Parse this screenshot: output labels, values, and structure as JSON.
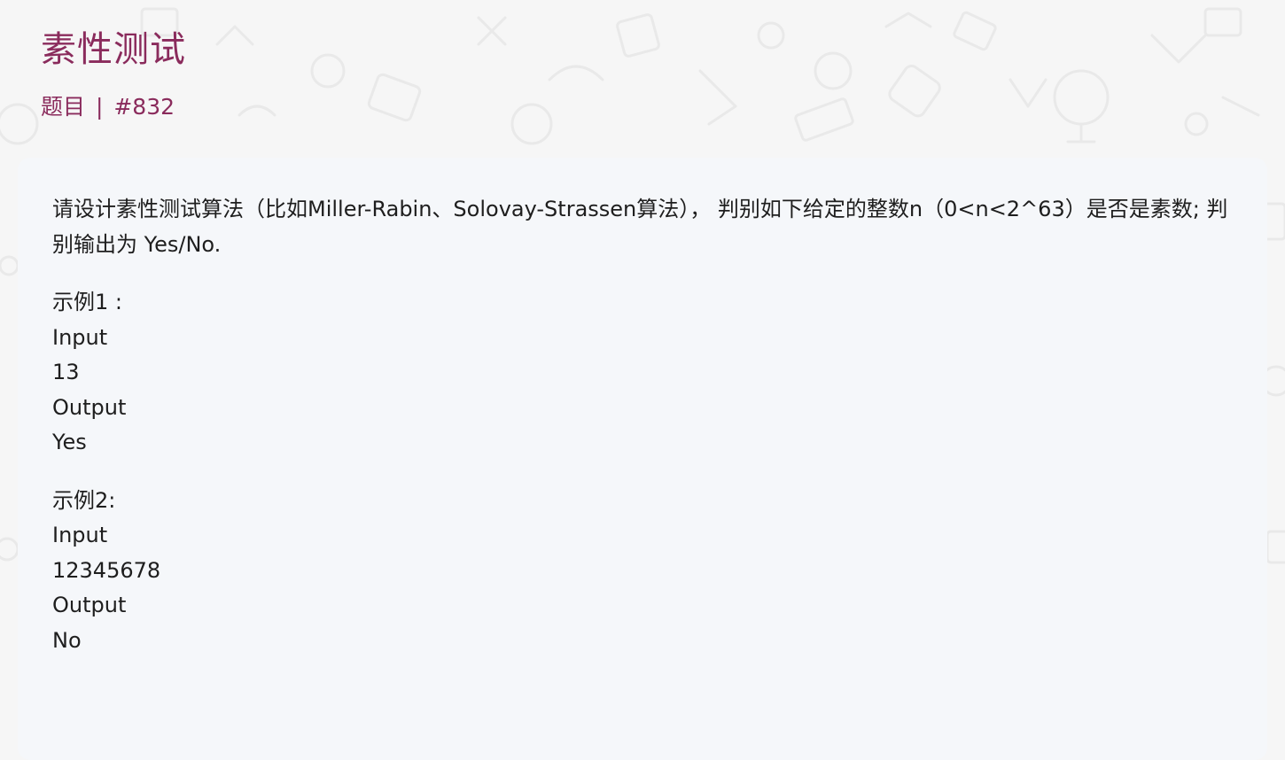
{
  "header": {
    "title": "素性测试",
    "category": "题目",
    "separator": "|",
    "problem_id": "#832"
  },
  "problem": {
    "description": "请设计素性测试算法（比如Miller-Rabin、Solovay-Strassen算法）， 判别如下给定的整数n（0<n<2^63）是否是素数; 判别输出为 Yes/No.",
    "examples": [
      {
        "label": "示例1 :",
        "input_label": "Input",
        "input": "13",
        "output_label": "Output",
        "output": "Yes"
      },
      {
        "label": "示例2:",
        "input_label": "Input",
        "input": "12345678",
        "output_label": "Output",
        "output": "No"
      }
    ]
  },
  "colors": {
    "accent": "#8a2b5c",
    "background": "#f6f6f6",
    "card": "#f5f7fa",
    "text": "#1e1e1e"
  }
}
